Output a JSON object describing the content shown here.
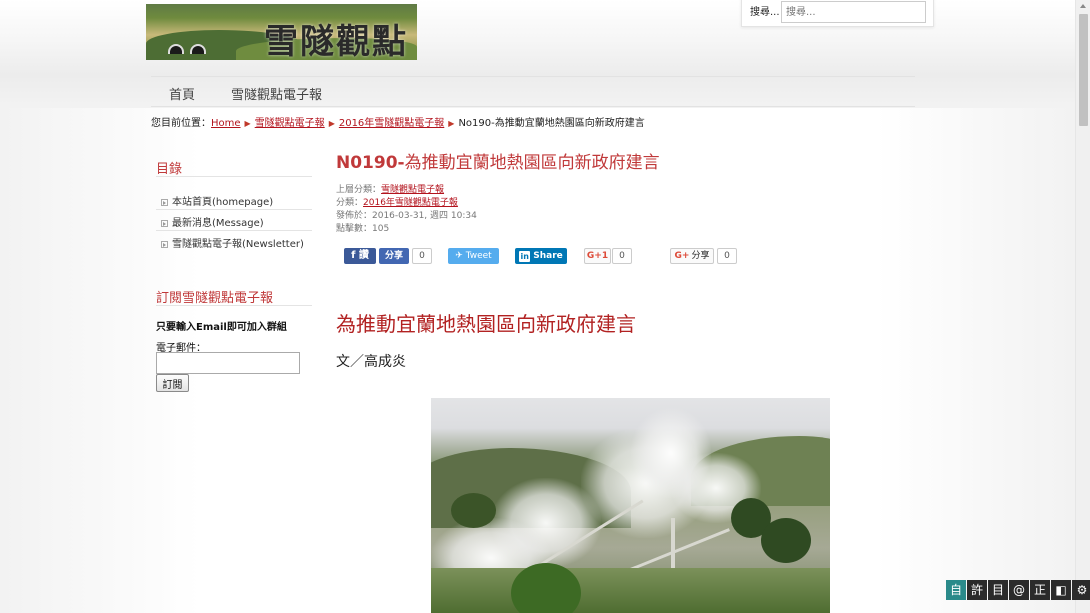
{
  "header": {
    "logo_text": "雪隧觀點",
    "search_label": "搜尋...",
    "search_placeholder": "搜尋..."
  },
  "nav": {
    "items": [
      {
        "label": "首頁"
      },
      {
        "label": "雪隧觀點電子報"
      }
    ]
  },
  "breadcrumb": {
    "prefix": "您目前位置：",
    "items": [
      "Home",
      "雪隧觀點電子報",
      "2016年雪隧觀點電子報"
    ],
    "current": "No190-為推動宜蘭地熱園區向新政府建言"
  },
  "sidebar": {
    "menu_title": "目錄",
    "menu_items": [
      {
        "label": "本站首頁(homepage)"
      },
      {
        "label": "最新消息(Message)"
      },
      {
        "label": "雪隧觀點電子報(Newsletter)"
      }
    ],
    "subscribe_title": "訂閱雪隧觀點電子報",
    "subscribe_note": "只要輸入Email即可加入群組",
    "email_label": "電子郵件：",
    "email_value": "",
    "subscribe_button": "訂閱"
  },
  "article": {
    "title_code": "N0190-",
    "title_text": "為推動宜蘭地熱園區向新政府建言",
    "meta": {
      "parent_label": "上層分類：",
      "parent_value": "雪隧觀點電子報",
      "category_label": "分類：",
      "category_value": "2016年雪隧觀點電子報",
      "published": "發佈於：2016-03-31, 週四 10:34",
      "hits": "點擊數：105"
    },
    "share": {
      "facebook_icon_label": "f 讚",
      "facebook_share_label": "分享",
      "facebook_count": "0",
      "twitter_label": "Tweet",
      "linkedin_label": "Share",
      "gplus_label": "G+1",
      "gplus_count": "0",
      "gshare_label": "分享",
      "gshare_count": "0"
    },
    "body_title": "為推動宜蘭地熱園區向新政府建言",
    "body_author": "文／高成炎"
  },
  "accessibility_toolbar": {
    "buttons": [
      "自",
      "許",
      "目",
      "@",
      "正",
      "◧",
      "⚙"
    ],
    "active_index": 0
  },
  "colors": {
    "accent_red": "#c0393a",
    "link_red": "#b3131d",
    "facebook": "#3b5998",
    "twitter": "#55acee",
    "linkedin": "#0077b5"
  }
}
